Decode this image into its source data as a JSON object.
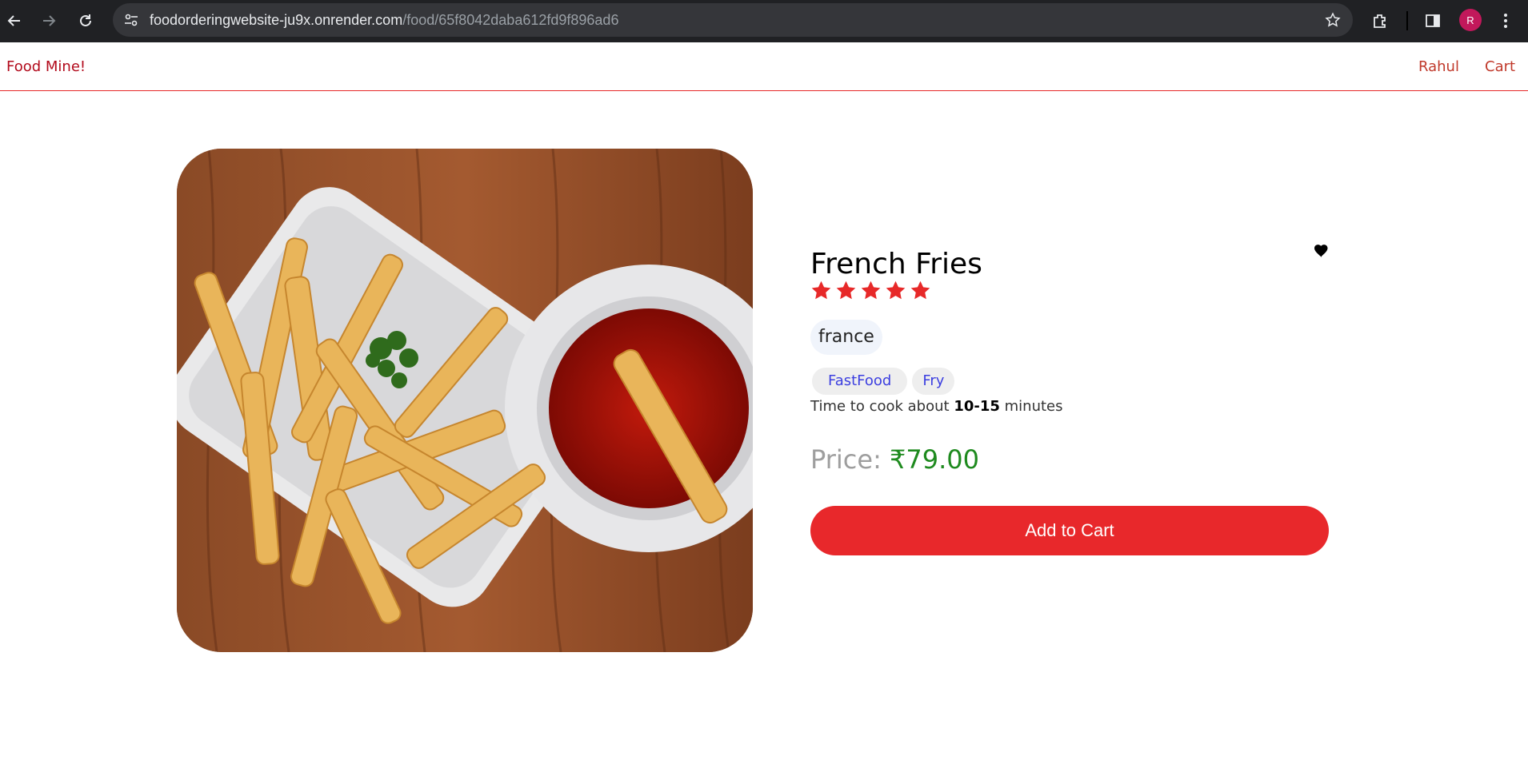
{
  "browser": {
    "url_host": "foodorderingwebsite-ju9x.onrender.com",
    "url_path": "/food/65f8042daba612fd9f896ad6",
    "profile_initial": "R",
    "icons": [
      "back-arrow-icon",
      "forward-arrow-icon",
      "reload-icon",
      "site-settings-icon",
      "bookmark-star-icon",
      "extensions-icon",
      "side-panel-icon",
      "more-menu-icon"
    ]
  },
  "header": {
    "logo": "Food Mine!",
    "nav": {
      "user": "Rahul",
      "cart": "Cart"
    },
    "border_color": "#e72929"
  },
  "food": {
    "name": "French Fries",
    "stars": 5,
    "origin": "france",
    "tags": [
      "FastFood",
      "Fry"
    ],
    "cook_time_prefix": "Time to cook about",
    "cook_time": "10-15",
    "cook_time_suffix": "minutes",
    "price_label": "Price:",
    "price_value": "₹79.00",
    "add_to_cart": "Add to Cart",
    "favorite": true
  },
  "colors": {
    "accent": "#e8282b",
    "price": "#1e8a1e",
    "tag_text": "#3c3fe0",
    "star": "#e72929"
  }
}
